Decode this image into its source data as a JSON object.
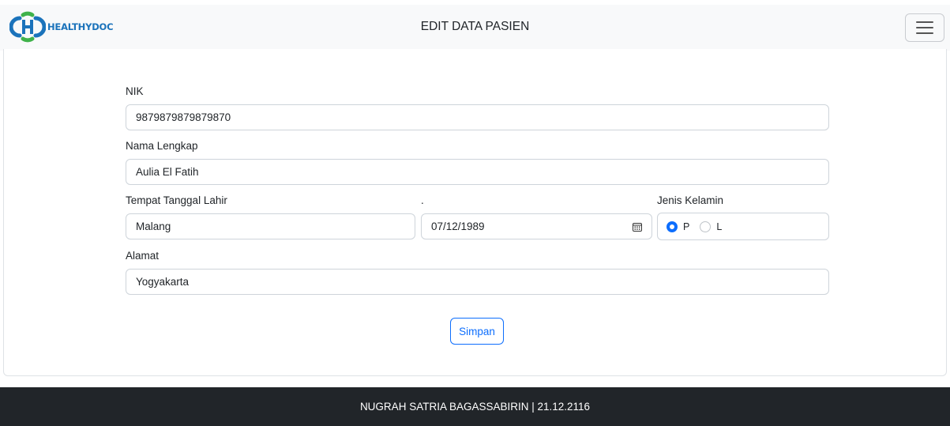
{
  "navbar": {
    "brand": "HEALTHYDOC",
    "title": "EDIT DATA PASIEN",
    "menu_icon": "hamburger-menu-icon"
  },
  "form": {
    "nik": {
      "label": "NIK",
      "value": "9879879879879870"
    },
    "nama": {
      "label": "Nama Lengkap",
      "value": "Aulia El Fatih"
    },
    "ttl": {
      "label": "Tempat Tanggal Lahir",
      "tempat_value": "Malang",
      "tanggal_label": ".",
      "tanggal_value": "07/12/1989",
      "calendar_icon": "calendar-icon"
    },
    "jenis_kelamin": {
      "label": "Jenis Kelamin",
      "options": [
        {
          "label": "P",
          "checked": true
        },
        {
          "label": "L",
          "checked": false
        }
      ]
    },
    "alamat": {
      "label": "Alamat",
      "value": "Yogyakarta"
    },
    "submit_label": "Simpan"
  },
  "footer": {
    "text": "NUGRAH SATRIA BAGASSABIRIN | 21.12.2116"
  },
  "colors": {
    "primary": "#0d6efd",
    "brand_blue": "#1b73bb",
    "brand_green": "#3fb24a",
    "footer_bg": "#212529",
    "navbar_bg": "#f8f9fa"
  }
}
